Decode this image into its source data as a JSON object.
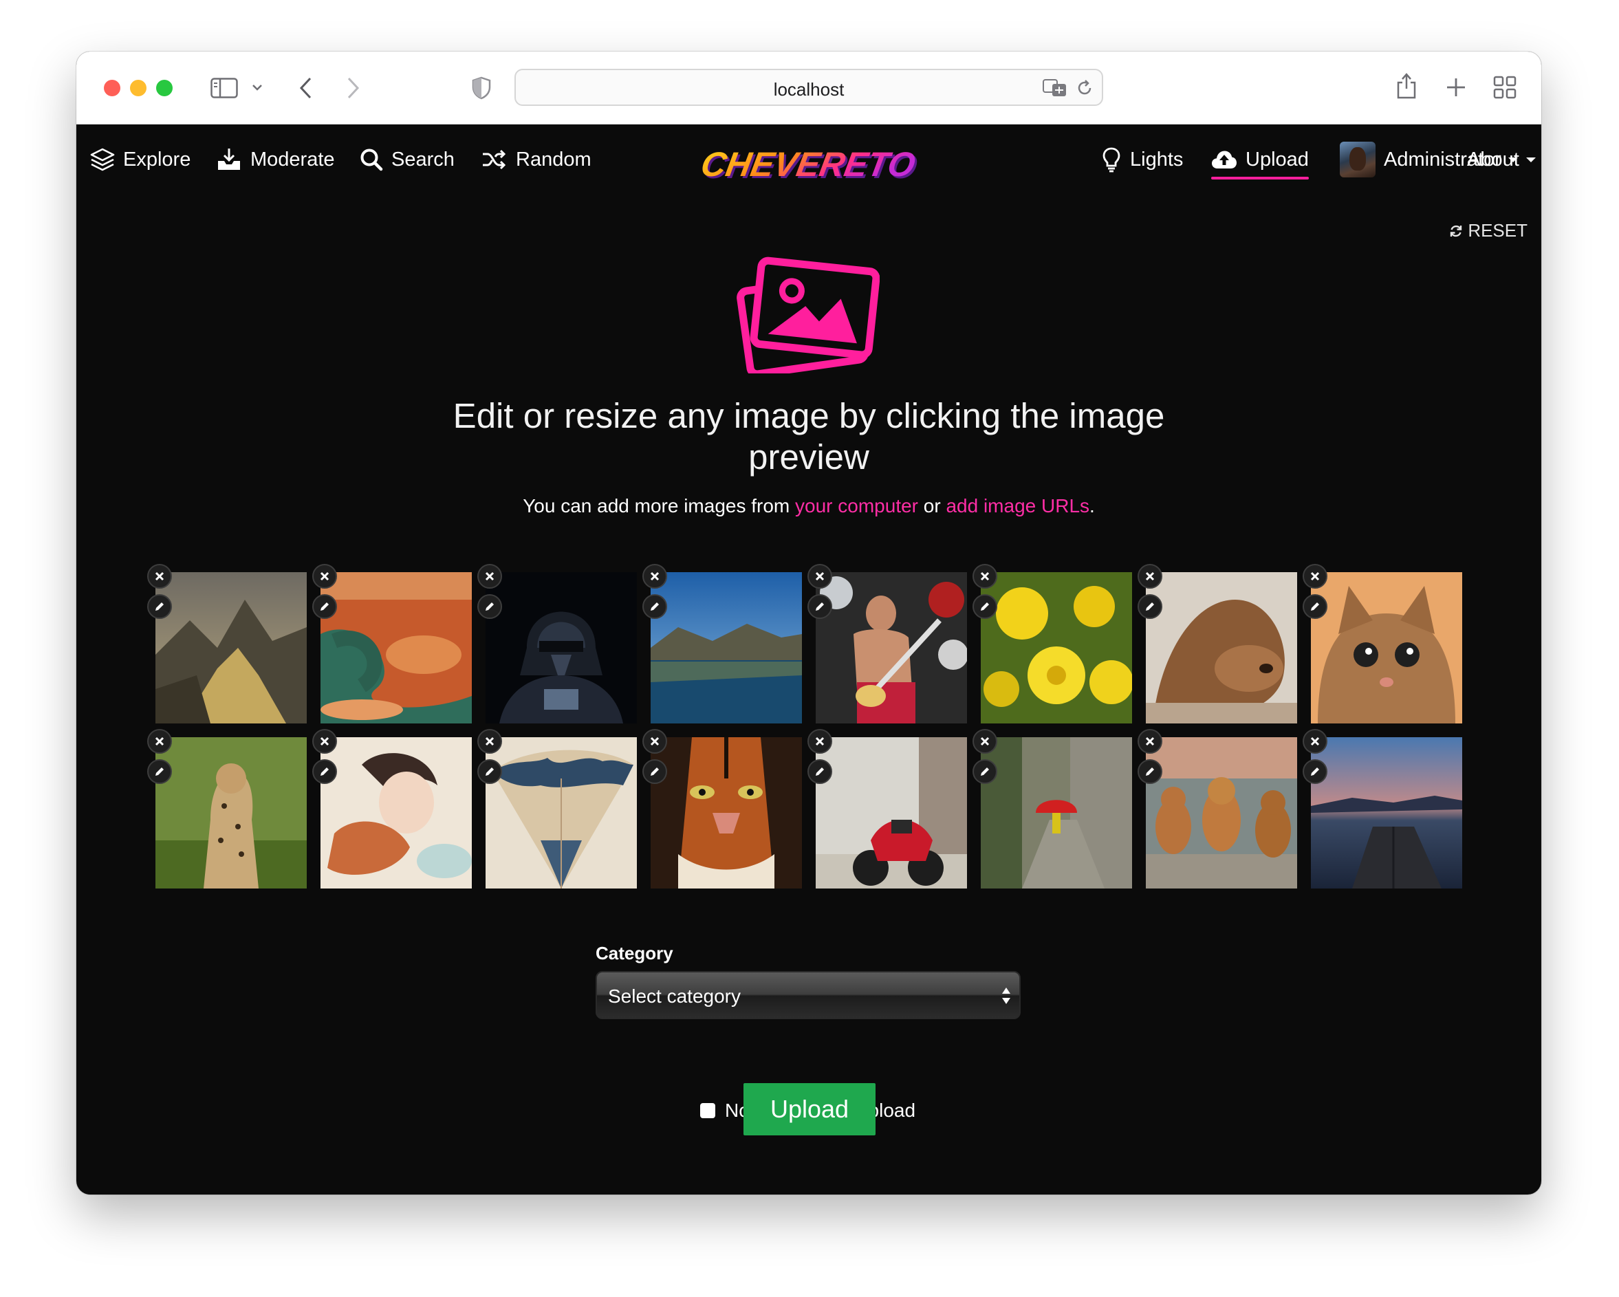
{
  "browser": {
    "url": "localhost"
  },
  "nav": {
    "explore": "Explore",
    "moderate": "Moderate",
    "search": "Search",
    "random": "Random",
    "logo_text": "CHEVERETO",
    "lights": "Lights",
    "upload": "Upload",
    "user": "Administrator",
    "about": "About"
  },
  "main": {
    "reset": "RESET",
    "headline": "Edit or resize any image by clicking the image preview",
    "sub_prefix": "You can add more images from",
    "sub_link_computer": "your computer",
    "sub_or": "or",
    "sub_link_urls": "add image URLs",
    "sub_suffix": ".",
    "category_label": "Category",
    "category_value": "Select category",
    "nsfw_label": "Not family safe upload",
    "upload_button": "Upload"
  },
  "images": [
    {
      "subject": "mountain-valley"
    },
    {
      "subject": "canyon-river"
    },
    {
      "subject": "darth-vader"
    },
    {
      "subject": "mountain-lake"
    },
    {
      "subject": "bass-player"
    },
    {
      "subject": "yellow-dandelions"
    },
    {
      "subject": "sleeping-sea-lion"
    },
    {
      "subject": "surprised-cat"
    },
    {
      "subject": "leopard"
    },
    {
      "subject": "watercolor-girl"
    },
    {
      "subject": "world-map-pencil"
    },
    {
      "subject": "tiger-face"
    },
    {
      "subject": "red-motorcycle"
    },
    {
      "subject": "red-umbrella-street"
    },
    {
      "subject": "three-puppies"
    },
    {
      "subject": "lake-pier-sunset"
    }
  ],
  "colors": {
    "accent": "#ff1f9d",
    "upload_button": "#1fa84e",
    "background": "#0b0b0b"
  }
}
